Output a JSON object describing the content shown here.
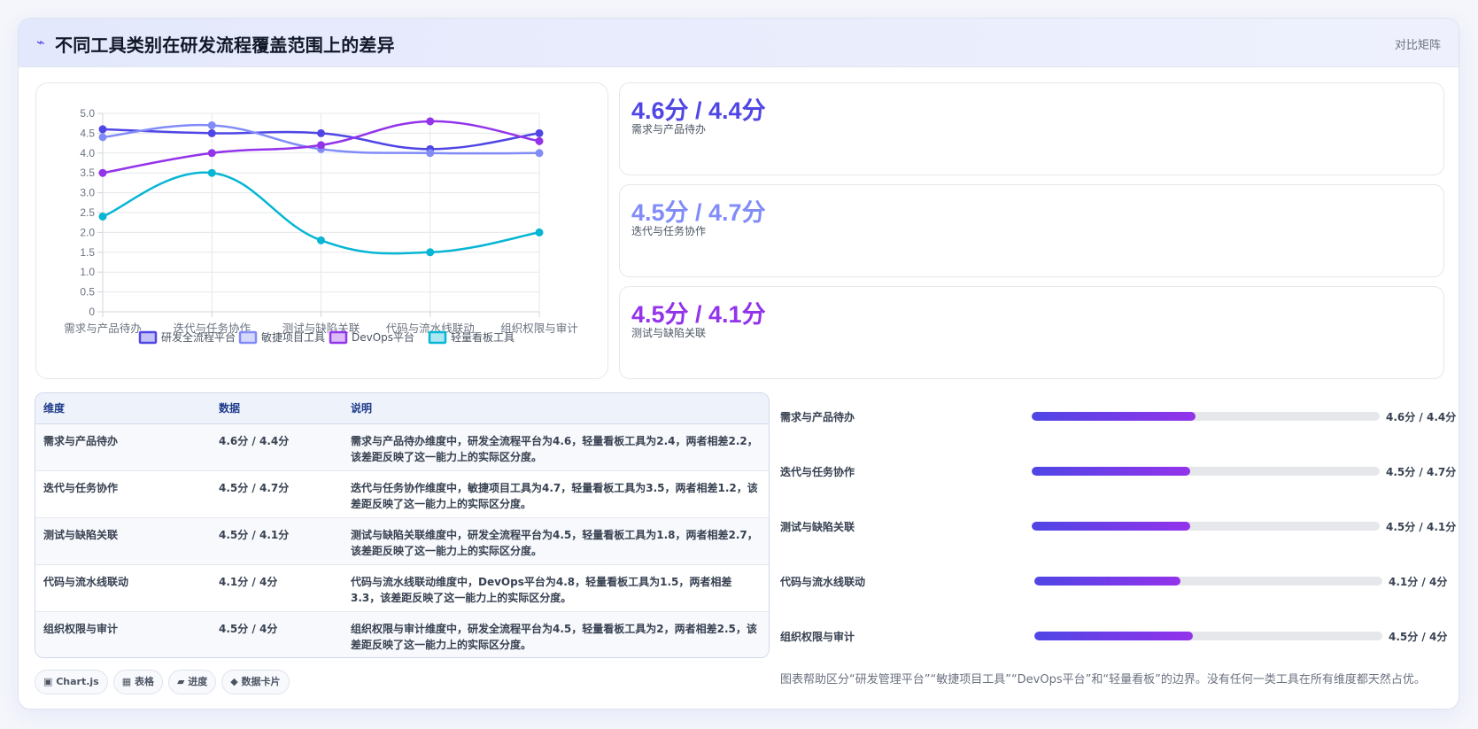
{
  "header": {
    "icon": "bolt-icon",
    "title": "不同工具类别在研发流程覆盖范围上的差异",
    "tag": "对比矩阵"
  },
  "chart_data": {
    "type": "line",
    "title": "",
    "xlabel": "",
    "ylabel": "",
    "categories": [
      "需求与产品待办",
      "迭代与任务协作",
      "测试与缺陷关联",
      "代码与流水线联动",
      "组织权限与审计"
    ],
    "ylim": [
      0,
      5
    ],
    "yticks": [
      0,
      0.5,
      1.0,
      1.5,
      2.0,
      2.5,
      3.0,
      3.5,
      4.0,
      4.5,
      5.0
    ],
    "grid": true,
    "legend_position": "bottom",
    "series": [
      {
        "name": "研发全流程平台",
        "color": "#4f46e5",
        "values": [
          4.6,
          4.5,
          4.5,
          4.1,
          4.5
        ]
      },
      {
        "name": "敏捷项目工具",
        "color": "#818cf8",
        "values": [
          4.4,
          4.7,
          4.1,
          4.0,
          4.0
        ]
      },
      {
        "name": "DevOps平台",
        "color": "#9333ea",
        "values": [
          3.5,
          4.0,
          4.2,
          4.8,
          4.3
        ]
      },
      {
        "name": "轻量看板工具",
        "color": "#06b6d4",
        "values": [
          2.4,
          3.5,
          1.8,
          1.5,
          2.0
        ]
      }
    ]
  },
  "stats": [
    {
      "value": "4.6分 / 4.4分",
      "label": "需求与产品待办",
      "color": "#4f46e5"
    },
    {
      "value": "4.5分 / 4.7分",
      "label": "迭代与任务协作",
      "color": "#818cf8"
    },
    {
      "value": "4.5分 / 4.1分",
      "label": "测试与缺陷关联",
      "color": "#9333ea"
    }
  ],
  "table": {
    "headers": [
      "维度",
      "数据",
      "说明"
    ],
    "rows": [
      {
        "dim": "需求与产品待办",
        "data": "4.6分 / 4.4分",
        "desc": "需求与产品待办维度中，研发全流程平台为4.6，轻量看板工具为2.4，两者相差2.2，该差距反映了这一能力上的实际区分度。"
      },
      {
        "dim": "迭代与任务协作",
        "data": "4.5分 / 4.7分",
        "desc": "迭代与任务协作维度中，敏捷项目工具为4.7，轻量看板工具为3.5，两者相差1.2，该差距反映了这一能力上的实际区分度。"
      },
      {
        "dim": "测试与缺陷关联",
        "data": "4.5分 / 4.1分",
        "desc": "测试与缺陷关联维度中，研发全流程平台为4.5，轻量看板工具为1.8，两者相差2.7，该差距反映了这一能力上的实际区分度。"
      },
      {
        "dim": "代码与流水线联动",
        "data": "4.1分 / 4分",
        "desc": "代码与流水线联动维度中，DevOps平台为4.8，轻量看板工具为1.5，两者相差3.3，该差距反映了这一能力上的实际区分度。"
      },
      {
        "dim": "组织权限与审计",
        "data": "4.5分 / 4分",
        "desc": "组织权限与审计维度中，研发全流程平台为4.5，轻量看板工具为2，两者相差2.5，该差距反映了这一能力上的实际区分度。"
      }
    ]
  },
  "chips": [
    {
      "icon": "chart-icon",
      "label": "▣ Chart.js"
    },
    {
      "icon": "table-icon",
      "label": "▦ 表格"
    },
    {
      "icon": "progress-icon",
      "label": "▰ 进度"
    },
    {
      "icon": "card-icon",
      "label": "◆ 数据卡片"
    }
  ],
  "progress": [
    {
      "label": "需求与产品待办",
      "value": "4.6分 / 4.4分",
      "fraction": 0.47
    },
    {
      "label": "迭代与任务协作",
      "value": "4.5分 / 4.7分",
      "fraction": 0.455
    },
    {
      "label": "测试与缺陷关联",
      "value": "4.5分 / 4.1分",
      "fraction": 0.455
    },
    {
      "label": "代码与流水线联动",
      "value": "4.1分 / 4分",
      "fraction": 0.42
    },
    {
      "label": "组织权限与审计",
      "value": "4.5分 / 4分",
      "fraction": 0.455
    }
  ],
  "note": "图表帮助区分“研发管理平台”“敏捷项目工具”“DevOps平台”和“轻量看板”的边界。没有任何一类工具在所有维度都天然占优。"
}
